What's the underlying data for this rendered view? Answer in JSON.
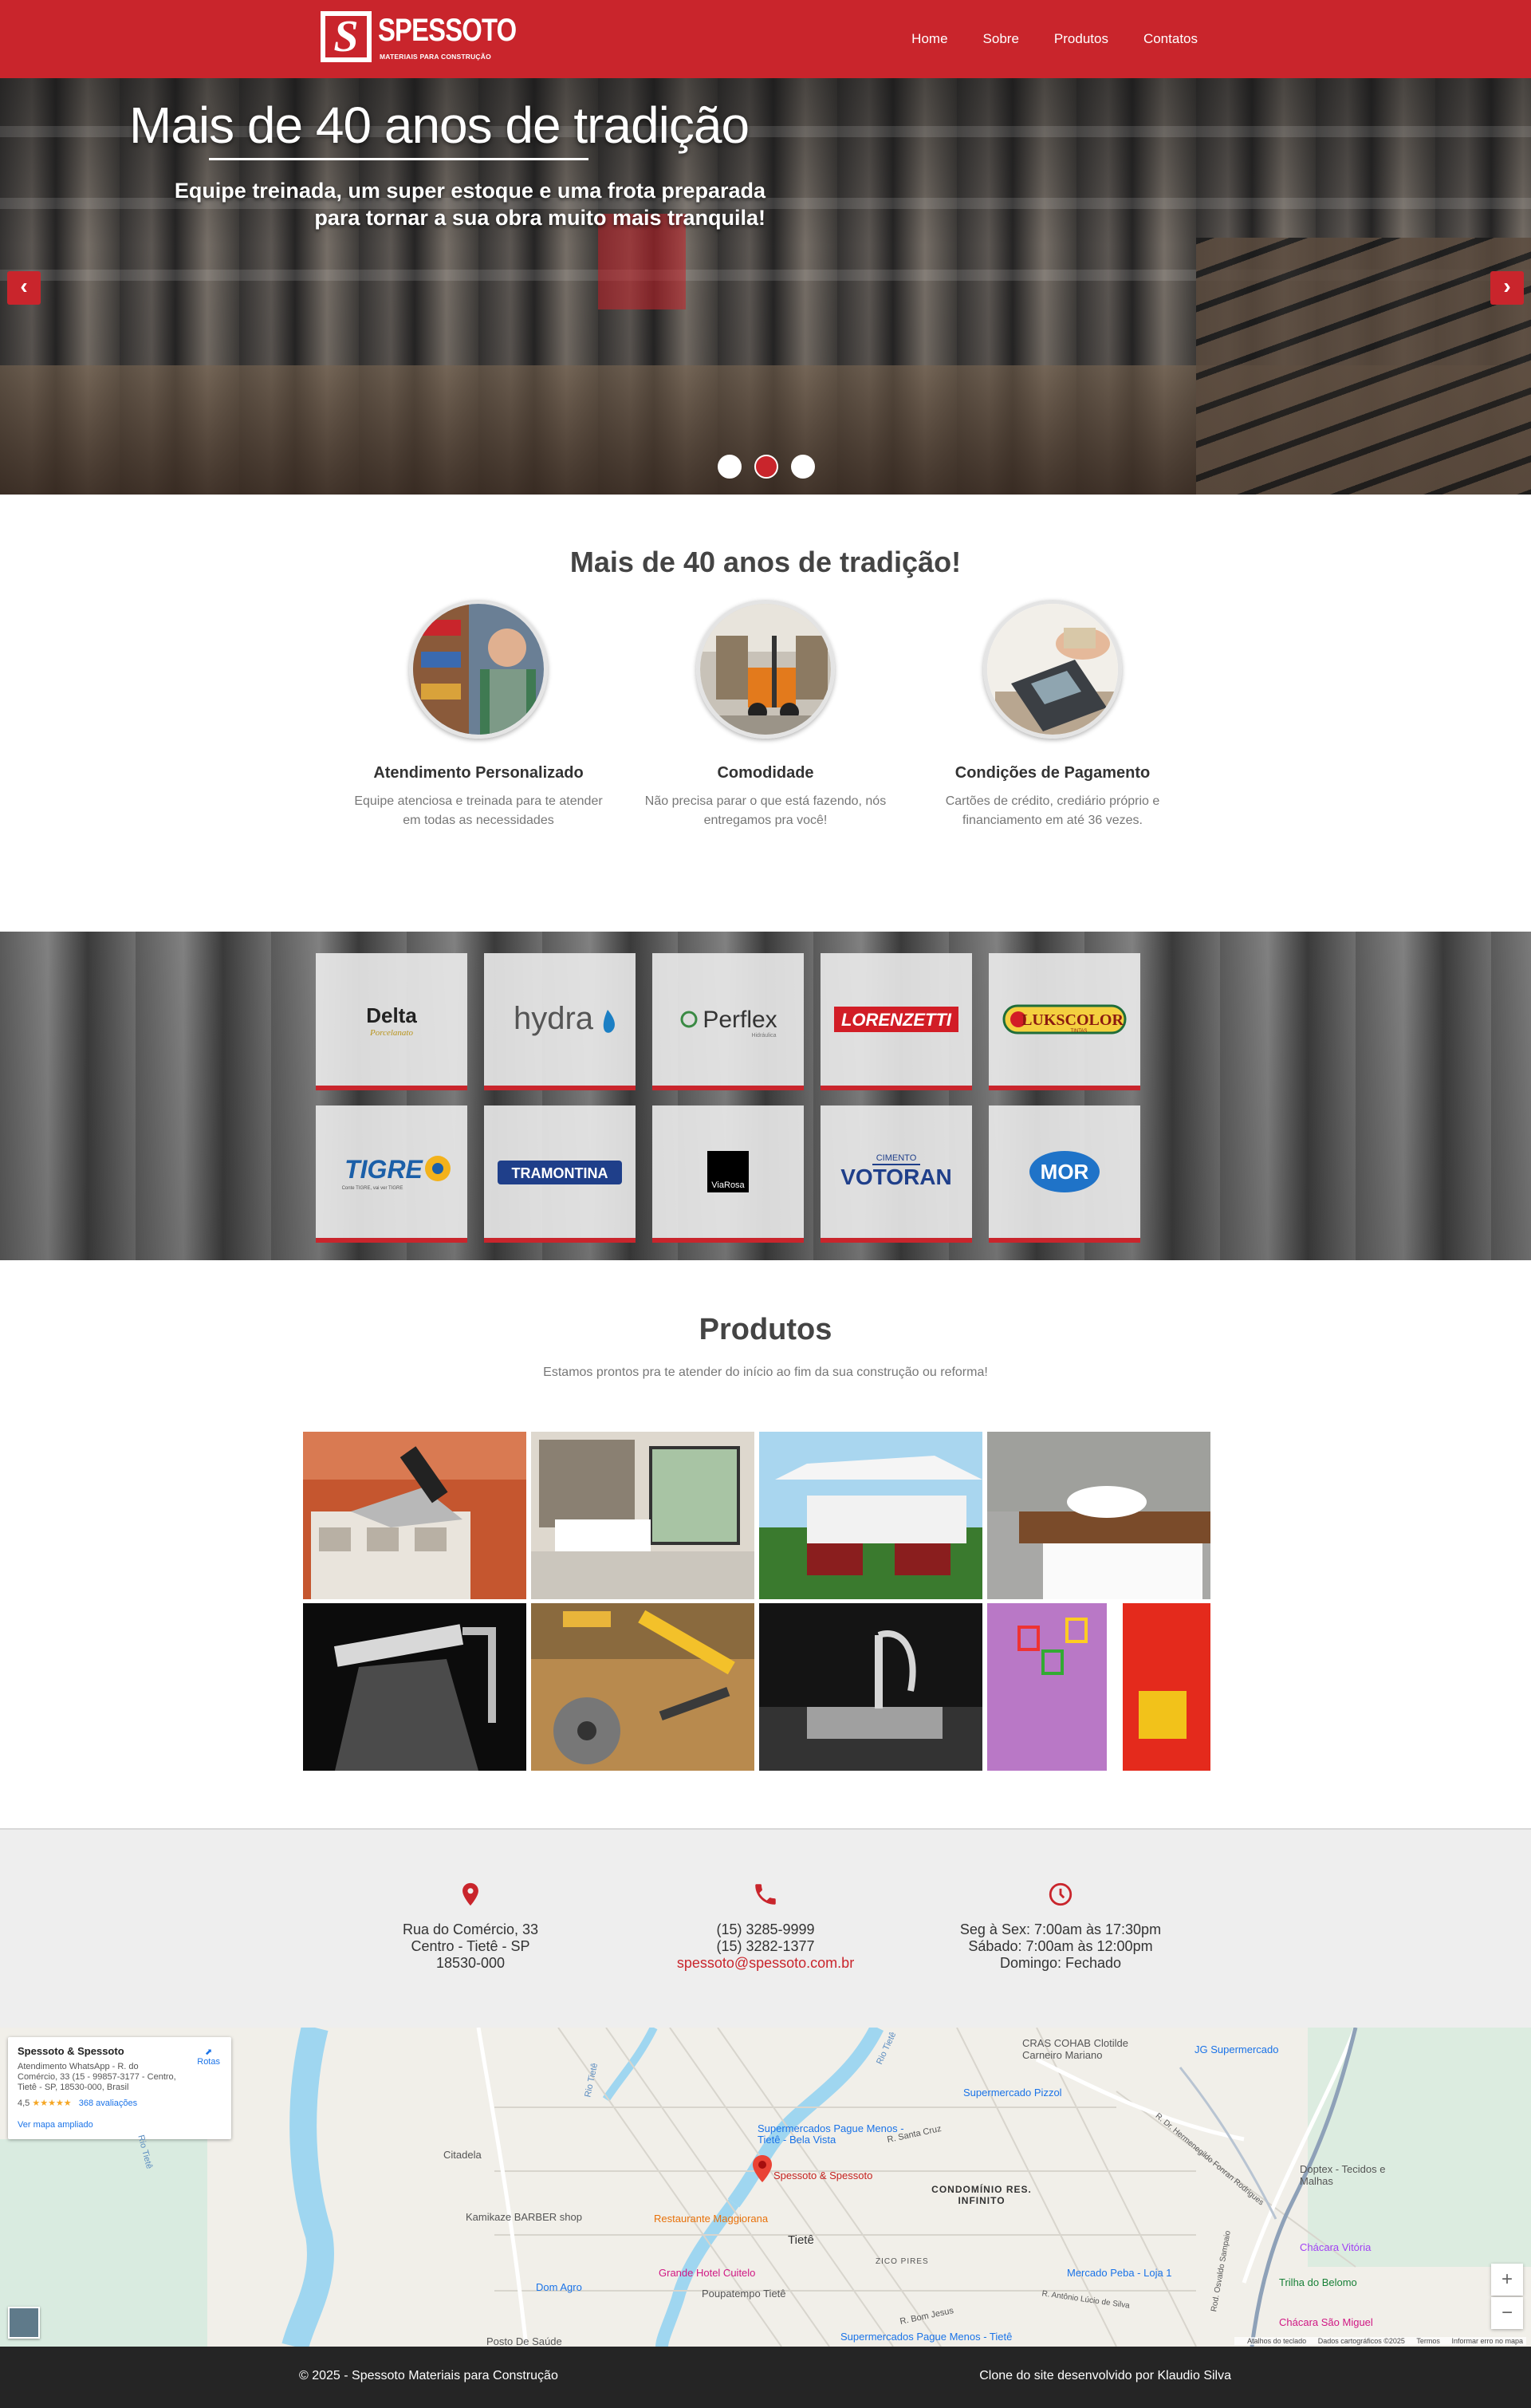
{
  "brand": {
    "name": "SPESSOTO",
    "tagline": "MATERIAIS PARA CONSTRUÇÃO",
    "color": "#c9252c"
  },
  "nav": {
    "items": [
      {
        "label": "Home"
      },
      {
        "label": "Sobre"
      },
      {
        "label": "Produtos"
      },
      {
        "label": "Contatos"
      }
    ]
  },
  "hero": {
    "title": "Mais de 40 anos de tradição",
    "subtitle_line1": "Equipe treinada, um super estoque e uma frota preparada",
    "subtitle_line2": "para tornar a sua obra muito mais tranquila!",
    "prev_icon": "chevron-left-icon",
    "next_icon": "chevron-right-icon",
    "prev_label": "‹",
    "next_label": "›",
    "slides_count": 3,
    "active_slide": 2
  },
  "features": {
    "title": "Mais de 40 anos de tradição!",
    "items": [
      {
        "title": "Atendimento Personalizado",
        "text": "Equipe atenciosa e treinada para te atender em todas as necessidades"
      },
      {
        "title": "Comodidade",
        "text": "Não precisa parar o que está fazendo, nós entregamos pra você!"
      },
      {
        "title": "Condições de Pagamento",
        "text": "Cartões de crédito, crediário próprio e financiamento em até 36 vezes."
      }
    ]
  },
  "brands": {
    "row1": [
      "Delta",
      "hydra",
      "Perflex",
      "LORENZETTI",
      "LUKSCOLOR"
    ],
    "row2": [
      "TIGRE",
      "TRAMONTINA",
      "ViaRosa",
      "VOTORAN",
      "MOR"
    ],
    "delta_sub": "Porcelanato",
    "perflex_sub": "Hidráulica",
    "luks_sub": "TINTAS",
    "tigre_sub": "Conte TIGRE, vai ver TIGRE",
    "votoran_top": "CIMENTO"
  },
  "produtos": {
    "title": "Produtos",
    "subtitle": "Estamos prontos pra te atender do início ao fim da sua construção ou reforma!",
    "tiles": [
      "construcao",
      "pisos",
      "jardim",
      "banheiro",
      "chuveiros",
      "ferramentas",
      "cozinha",
      "decoracao"
    ]
  },
  "contact": {
    "address": {
      "icon": "map-pin-icon",
      "line1": "Rua do Comércio, 33",
      "line2": "Centro - Tietê - SP",
      "line3": "18530-000"
    },
    "phone": {
      "icon": "phone-icon",
      "line1": "(15) 3285-9999",
      "line2": "(15) 3282-1377",
      "email": "spessoto@spessoto.com.br"
    },
    "hours": {
      "icon": "clock-icon",
      "line1": "Seg à Sex: 7:00am às 17:30pm",
      "line2": "Sábado: 7:00am às 12:00pm",
      "line3": "Domingo: Fechado"
    }
  },
  "map": {
    "card": {
      "name": "Spessoto & Spessoto",
      "address": "Atendimento WhatsApp - R. do Comércio, 33 (15 - 99857-3177 - Centro, Tietê - SP, 18530-000, Brasil",
      "rating": "4,5",
      "stars": "★★★★★",
      "reviews": "368 avaliações",
      "larger_map": "Ver mapa ampliado",
      "directions": "Rotas"
    },
    "labels": {
      "cohab": "CRAS COHAB Clotilde Carneiro Mariano",
      "jg": "JG Supermercado",
      "pizzol": "Supermercado Pizzol",
      "citadela": "Citadela",
      "pague_menos": "Supermercados Pague Menos - Tietê - Bela Vista",
      "spessoto": "Spessoto & Spessoto",
      "condominio": "CONDOMÍNIO RES. INFINITO",
      "kamikaze": "Kamikaze BARBER shop",
      "maggiorana": "Restaurante Maggiorana",
      "tiete": "Tietê",
      "zico": "ZICO PIRES",
      "grande_hotel": "Grande Hotel Cuitelo",
      "peba": "Mercado Peba - Loja 1",
      "dom_agro": "Dom Agro",
      "poupatempo": "Poupatempo Tietê",
      "doptex": "Doptex - Tecidos e Malhas",
      "vitoria": "Chácara Vitória",
      "belomo": "Trilha do Belomo",
      "sao_miguel": "Chácara São Miguel",
      "posto": "Posto De Saúde",
      "pague_menos2": "Supermercados Pague Menos - Tietê",
      "santa_cruz": "R. Santa Cruz",
      "bom_jesus": "R. Bom Jesus",
      "antonio": "R. Antônio Lúcio de Silva",
      "hermenegildo": "R. Dr. Hermenegildo Fonran Rodrigues",
      "rod": "Rod. Osvaldo Sampaio",
      "rio_tiete": "Rio Tietê",
      "rio_tiete2": "Rio Tietê",
      "rio_tiete3": "Rio Tietê"
    },
    "zoom_in": "+",
    "zoom_out": "−",
    "footer": {
      "shortcuts": "Atalhos do teclado",
      "data": "Dados cartográficos ©2025",
      "terms": "Termos",
      "report": "Informar erro no mapa"
    }
  },
  "footer": {
    "left": "© 2025 - Spessoto Materiais para Construção",
    "right": "Clone do site desenvolvido por Klaudio Silva"
  }
}
